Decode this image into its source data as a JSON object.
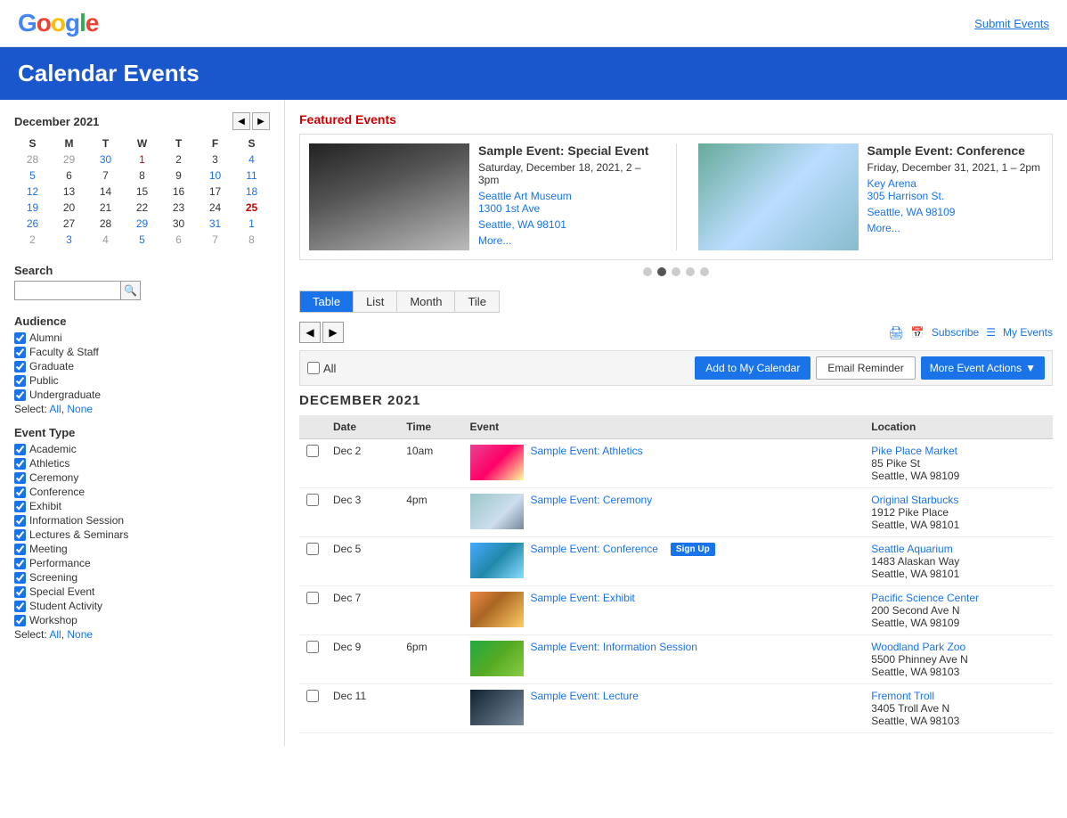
{
  "header": {
    "logo_g": "G",
    "logo_o1": "o",
    "logo_o2": "o",
    "logo_g2": "g",
    "logo_l": "l",
    "logo_e": "e",
    "submit_link": "Submit Events"
  },
  "page": {
    "title": "Calendar Events"
  },
  "mini_calendar": {
    "title": "December 2021",
    "days_of_week": [
      "S",
      "M",
      "T",
      "W",
      "T",
      "F",
      "S"
    ],
    "weeks": [
      [
        {
          "d": "28",
          "class": "other-month"
        },
        {
          "d": "29",
          "class": "other-month"
        },
        {
          "d": "30",
          "class": "highlight-blue other-month"
        },
        {
          "d": "1",
          "class": "highlight-red"
        },
        {
          "d": "2",
          "class": ""
        },
        {
          "d": "3",
          "class": ""
        },
        {
          "d": "4",
          "class": "sat-col"
        }
      ],
      [
        {
          "d": "5",
          "class": "sun-col"
        },
        {
          "d": "6",
          "class": ""
        },
        {
          "d": "7",
          "class": ""
        },
        {
          "d": "8",
          "class": ""
        },
        {
          "d": "9",
          "class": ""
        },
        {
          "d": "10",
          "class": "highlight-blue"
        },
        {
          "d": "11",
          "class": "sat-col highlight-blue"
        }
      ],
      [
        {
          "d": "12",
          "class": "sun-col"
        },
        {
          "d": "13",
          "class": ""
        },
        {
          "d": "14",
          "class": ""
        },
        {
          "d": "15",
          "class": ""
        },
        {
          "d": "16",
          "class": ""
        },
        {
          "d": "17",
          "class": ""
        },
        {
          "d": "18",
          "class": "sat-col"
        }
      ],
      [
        {
          "d": "19",
          "class": "sun-col"
        },
        {
          "d": "20",
          "class": ""
        },
        {
          "d": "21",
          "class": ""
        },
        {
          "d": "22",
          "class": ""
        },
        {
          "d": "23",
          "class": ""
        },
        {
          "d": "24",
          "class": ""
        },
        {
          "d": "25",
          "class": "today"
        }
      ],
      [
        {
          "d": "26",
          "class": "sun-col"
        },
        {
          "d": "27",
          "class": ""
        },
        {
          "d": "28",
          "class": ""
        },
        {
          "d": "29",
          "class": "highlight-blue"
        },
        {
          "d": "30",
          "class": ""
        },
        {
          "d": "31",
          "class": "highlight-blue"
        },
        {
          "d": "1",
          "class": "sat-col highlight-blue other-month"
        }
      ],
      [
        {
          "d": "2",
          "class": "sun-col other-month"
        },
        {
          "d": "3",
          "class": "highlight-blue other-month"
        },
        {
          "d": "4",
          "class": "other-month"
        },
        {
          "d": "5",
          "class": "highlight-blue other-month"
        },
        {
          "d": "6",
          "class": "other-month"
        },
        {
          "d": "7",
          "class": "other-month"
        },
        {
          "d": "8",
          "class": "sat-col other-month"
        }
      ]
    ]
  },
  "search": {
    "label": "Search",
    "placeholder": ""
  },
  "audience": {
    "title": "Audience",
    "items": [
      {
        "label": "Alumni",
        "checked": true
      },
      {
        "label": "Faculty & Staff",
        "checked": true
      },
      {
        "label": "Graduate",
        "checked": true
      },
      {
        "label": "Public",
        "checked": true
      },
      {
        "label": "Undergraduate",
        "checked": true
      }
    ],
    "select_all": "All",
    "select_none": "None"
  },
  "event_type": {
    "title": "Event Type",
    "items": [
      {
        "label": "Academic",
        "checked": true
      },
      {
        "label": "Athletics",
        "checked": true
      },
      {
        "label": "Ceremony",
        "checked": true
      },
      {
        "label": "Conference",
        "checked": true
      },
      {
        "label": "Exhibit",
        "checked": true
      },
      {
        "label": "Information Session",
        "checked": true
      },
      {
        "label": "Lectures & Seminars",
        "checked": true
      },
      {
        "label": "Meeting",
        "checked": true
      },
      {
        "label": "Performance",
        "checked": true
      },
      {
        "label": "Screening",
        "checked": true
      },
      {
        "label": "Special Event",
        "checked": true
      },
      {
        "label": "Student Activity",
        "checked": true
      },
      {
        "label": "Workshop",
        "checked": true
      }
    ],
    "select_all": "All",
    "select_none": "None"
  },
  "featured": {
    "title": "Featured Events",
    "events": [
      {
        "title": "Sample Event: Special Event",
        "date": "Saturday, December 18, 2021, 2 – 3pm",
        "venue": "Seattle Art Museum",
        "address1": "1300 1st Ave",
        "address2": "Seattle, WA 98101",
        "more": "More..."
      },
      {
        "title": "Sample Event: Conference",
        "date": "Friday, December 31, 2021, 1 – 2pm",
        "venue": "Key Arena",
        "address1": "305 Harrison St.",
        "address2": "Seattle, WA 98109",
        "more": "More..."
      }
    ],
    "dots": 5,
    "active_dot": 1
  },
  "view_tabs": {
    "tabs": [
      "Table",
      "List",
      "Month",
      "Tile"
    ],
    "active": "Table"
  },
  "controls": {
    "subscribe": "Subscribe",
    "my_events": "My Events",
    "all_label": "All",
    "add_to_calendar": "Add to My Calendar",
    "email_reminder": "Email Reminder",
    "more_actions": "More Event Actions"
  },
  "events_table": {
    "month_heading": "DECEMBER 2021",
    "columns": [
      "Date",
      "Time",
      "Event",
      "Location"
    ],
    "rows": [
      {
        "date": "Dec 2",
        "time": "10am",
        "img_class": "img-flowers",
        "event_name": "Sample Event: Athletics",
        "sign_up": false,
        "location_name": "Pike Place Market",
        "location_addr1": "85 Pike St",
        "location_addr2": "Seattle, WA 98109"
      },
      {
        "date": "Dec 3",
        "time": "4pm",
        "img_class": "img-mountain",
        "event_name": "Sample Event: Ceremony",
        "sign_up": false,
        "location_name": "Original Starbucks",
        "location_addr1": "1912 Pike Place",
        "location_addr2": "Seattle, WA 98101"
      },
      {
        "date": "Dec 5",
        "time": "",
        "img_class": "img-lake",
        "event_name": "Sample Event: Conference",
        "sign_up": true,
        "sign_up_label": "Sign Up",
        "location_name": "Seattle Aquarium",
        "location_addr1": "1483 Alaskan Way",
        "location_addr2": "Seattle, WA 98101"
      },
      {
        "date": "Dec 7",
        "time": "",
        "img_class": "img-field",
        "event_name": "Sample Event: Exhibit",
        "sign_up": false,
        "location_name": "Pacific Science Center",
        "location_addr1": "200 Second Ave N",
        "location_addr2": "Seattle, WA 98109"
      },
      {
        "date": "Dec 9",
        "time": "6pm",
        "img_class": "img-trees",
        "event_name": "Sample Event: Information Session",
        "sign_up": false,
        "location_name": "Woodland Park Zoo",
        "location_addr1": "5500 Phinney Ave N",
        "location_addr2": "Seattle, WA 98103"
      },
      {
        "date": "Dec 11",
        "time": "",
        "img_class": "img-night",
        "event_name": "Sample Event: Lecture",
        "sign_up": false,
        "location_name": "Fremont Troll",
        "location_addr1": "3405 Troll Ave N",
        "location_addr2": "Seattle, WA 98103"
      }
    ]
  }
}
